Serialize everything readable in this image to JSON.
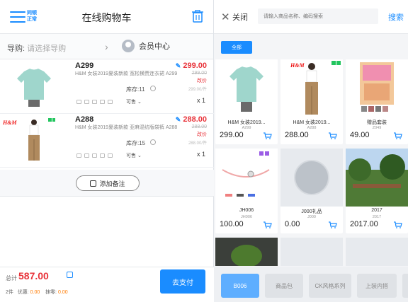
{
  "header": {
    "sync_tag_line1": "同顿",
    "sync_tag_line2": "正常",
    "title": "在线购物车"
  },
  "guide": {
    "label": "导购:",
    "placeholder": "请选择导购"
  },
  "member": {
    "label": "会员中心"
  },
  "cart_items": [
    {
      "code": "A299",
      "name": "H&M 女装2019夏装新款 宽松横贾连衣裙 A299",
      "price": "299.00",
      "orig_price": "299.00",
      "cut_label": "改价",
      "unit_price": "299.00/件",
      "stock": "库存:11",
      "status": "可售",
      "qty": "x 1"
    },
    {
      "code": "A288",
      "name": "H&M 女装2019夏装新款 亚麻混纺版袋裤 A288",
      "price": "288.00",
      "orig_price": "288.00",
      "cut_label": "改价",
      "unit_price": "288.00/件",
      "stock": "库存:15",
      "status": "可售",
      "qty": "x 1"
    }
  ],
  "note_button": "添加备注",
  "footer": {
    "total_label": "总计",
    "total": "587.00",
    "count": "2件",
    "discount_label": "优惠:",
    "discount": "0.00",
    "erase_label": "抹零:",
    "erase": "0.00",
    "pay_button": "去支付"
  },
  "right_top": {
    "close": "关闭",
    "search_placeholder": "请输入商品名称、编码搜索",
    "search_button": "搜索"
  },
  "category_all": "全部",
  "products": [
    {
      "name": "H&M 女装2019...",
      "code": "A299",
      "price": "299.00"
    },
    {
      "name": "H&M 女装2019...",
      "code": "A288",
      "price": "288.00"
    },
    {
      "name": "赠品套装",
      "code": "Z049",
      "price": "49.00"
    },
    {
      "name": "JH006",
      "code": "JH006",
      "price": "100.00"
    },
    {
      "name": "J000礼品",
      "code": "J000",
      "price": "0.00"
    },
    {
      "name": "2017",
      "code": "2017",
      "price": "2017.00"
    }
  ],
  "brand_mark": "H&M",
  "bottom_tabs": [
    "B006",
    "商品包",
    "CK风格系列",
    "上装内搭"
  ],
  "colors": {
    "accent": "#1a8cff",
    "price": "#e8333a",
    "orange": "#ff7a00"
  }
}
